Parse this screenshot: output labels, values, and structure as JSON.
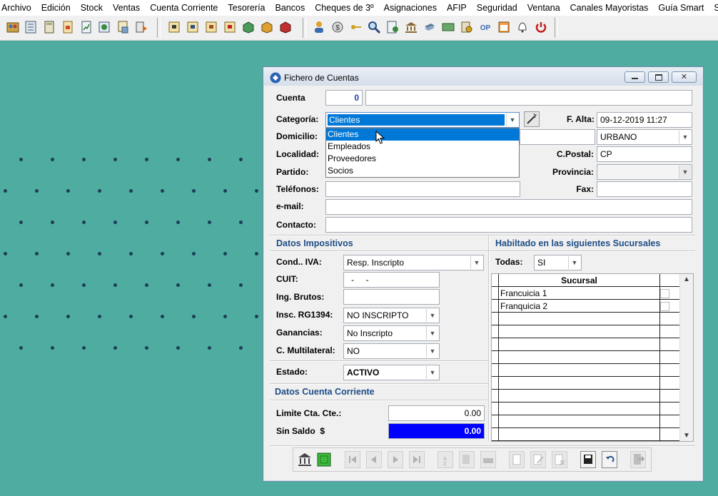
{
  "menu": [
    "Archivo",
    "Edición",
    "Stock",
    "Ventas",
    "Cuenta Corriente",
    "Tesorería",
    "Bancos",
    "Cheques de 3º",
    "Asignaciones",
    "AFIP",
    "Seguridad",
    "Ventana",
    "Canales Mayoristas",
    "Guía Smart",
    "Smart Coach"
  ],
  "window": {
    "title": "Fichero de Cuentas"
  },
  "form": {
    "cuenta_label": "Cuenta",
    "cuenta_value": "0",
    "cuenta_name": "",
    "categoria_label": "Categoría:",
    "categoria_value": "Clientes",
    "falta_label": "F. Alta:",
    "falta_value": "09-12-2019 11:27",
    "domicilio_label": "Domicilio:",
    "zona_value": "URBANO",
    "localidad_label": "Localidad:",
    "cpostal_label": "C.Postal:",
    "cpostal_value": "CP",
    "partido_label": "Partido:",
    "provincia_label": "Provincia:",
    "provincia_value": "",
    "telefonos_label": "Teléfonos:",
    "telefonos_value": "",
    "fax_label": "Fax:",
    "fax_value": "",
    "email_label": "e-mail:",
    "email_value": "",
    "contacto_label": "Contacto:",
    "contacto_value": ""
  },
  "dropdown": {
    "options": [
      "Clientes",
      "Empleados",
      "Proveedores",
      "Socios"
    ],
    "selected": "Clientes"
  },
  "impositivos": {
    "title": "Datos Impositivos",
    "condiva_label": "Cond.. IVA:",
    "condiva_value": "Resp. Inscripto",
    "cuit_label": "CUIT:",
    "cuit_value": "-     -",
    "ingbrutos_label": "Ing. Brutos:",
    "ingbrutos_value": "",
    "rg1394_label": "Insc. RG1394:",
    "rg1394_value": "NO INSCRIPTO",
    "ganancias_label": "Ganancias:",
    "ganancias_value": "No Inscripto",
    "multilateral_label": "C. Multilateral:",
    "multilateral_value": "NO",
    "estado_label": "Estado:",
    "estado_value": "ACTIVO"
  },
  "ctacte": {
    "title": "Datos Cuenta Corriente",
    "limite_label": "Limite Cta. Cte.:",
    "limite_value": "0.00",
    "saldo_label": "Sin Saldo  $",
    "saldo_value": "0.00"
  },
  "sucursales": {
    "title": "Habiltado en las siguientes Sucursales",
    "todas_label": "Todas:",
    "todas_value": "SI",
    "column": "Sucursal",
    "rows": [
      "Francuicia 1",
      "Franquicia 2"
    ]
  },
  "colors": {
    "accent": "#1e4d85",
    "saldo_bg": "#0000ff",
    "desktop": "#4eada0",
    "selection": "#0078d7"
  }
}
